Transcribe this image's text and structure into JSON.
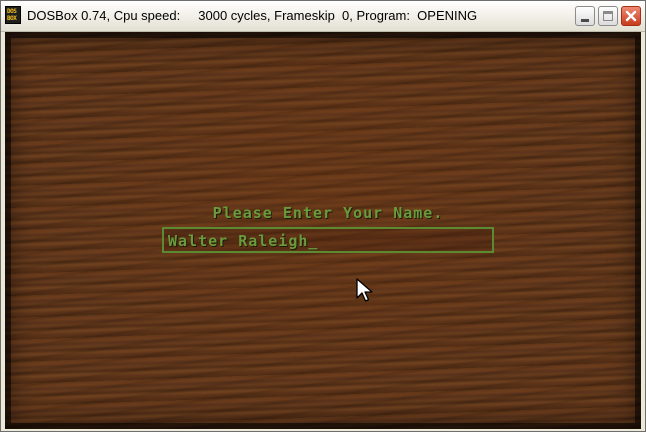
{
  "window": {
    "title": "DOSBox 0.74, Cpu speed:     3000 cycles, Frameskip  0, Program:  OPENING",
    "icon_name": "dosbox-icon",
    "icon_text_top": "DOS",
    "icon_text_bottom": "BOX",
    "buttons": [
      "minimize-icon",
      "maximize-icon",
      "close-icon"
    ]
  },
  "game": {
    "prompt": "Please Enter Your Name.",
    "name_value": "Walter Raleigh_",
    "background": "wood-grain-texture",
    "text_color": "#6b9a3c",
    "box_border_color": "#5c8a31"
  }
}
